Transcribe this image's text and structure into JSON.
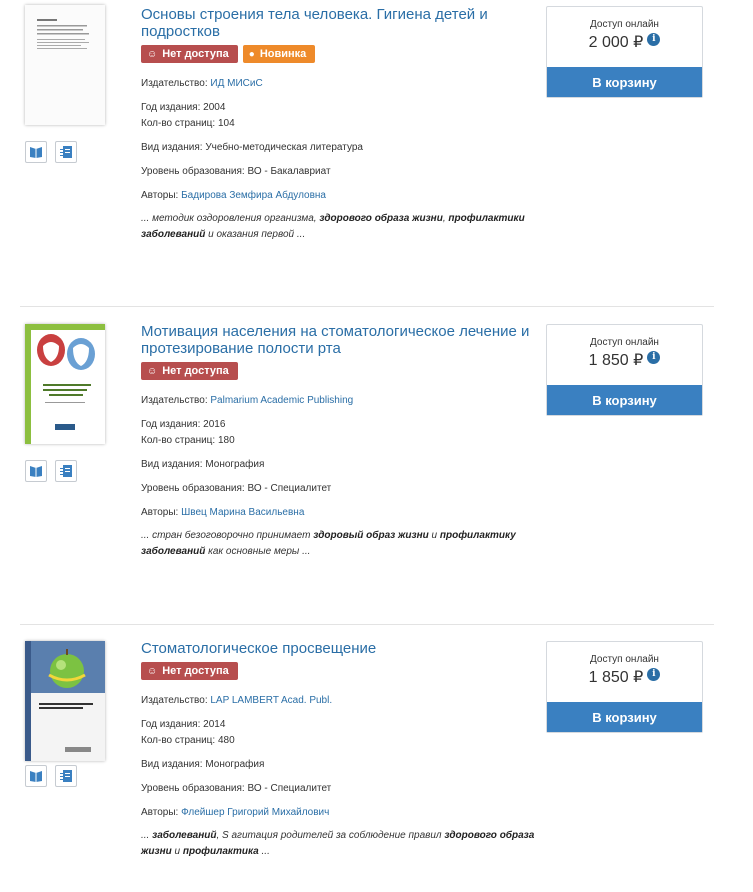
{
  "ui": {
    "badge_no_access": "Нет доступа",
    "badge_new": "Новинка",
    "publisher_label": "Издательство:",
    "year_label": "Год издания:",
    "pages_label": "Кол-во страниц:",
    "type_label": "Вид издания:",
    "level_label": "Уровень образования:",
    "authors_label": "Авторы:",
    "price_label": "Доступ онлайн",
    "cart_label": "В корзину",
    "colors": {
      "link": "#2a6ea6",
      "no_access": "#b74e4e",
      "new": "#ee8a2a",
      "cart": "#3a80c1"
    },
    "icons": [
      "book-reader-icon",
      "read-online-icon",
      "info-icon",
      "lock-icon",
      "dot-icon"
    ]
  },
  "items": [
    {
      "title": "Основы строения тела человека. Гигиена детей и подростков",
      "is_new": true,
      "publisher": "ИД МИСиС",
      "year": "2004",
      "pages": "104",
      "type": "Учебно-методическая литература",
      "level": "ВО - Бакалавриат",
      "authors": "Бадирова Земфира Абдуловна",
      "snippet": [
        {
          "t": "... методик оздоровления организма, ",
          "b": false
        },
        {
          "t": "здорового образа жизни",
          "b": true
        },
        {
          "t": ", ",
          "b": false
        },
        {
          "t": "профилактики заболеваний",
          "b": true
        },
        {
          "t": " и оказания первой ...",
          "b": false
        }
      ],
      "price": "2 000 ₽"
    },
    {
      "title": "Мотивация населения на стоматологическое лечение и протезирование полости рта",
      "is_new": false,
      "publisher": "Palmarium Academic Publishing",
      "year": "2016",
      "pages": "180",
      "type": "Монография",
      "level": "ВО - Специалитет",
      "authors": "Швец Марина Васильевна",
      "snippet": [
        {
          "t": "... стран безоговорочно принимает ",
          "b": false
        },
        {
          "t": "здоровый образ жизни",
          "b": true
        },
        {
          "t": " и ",
          "b": false
        },
        {
          "t": "профилактику заболеваний",
          "b": true
        },
        {
          "t": " как основные меры ...",
          "b": false
        }
      ],
      "price": "1 850 ₽"
    },
    {
      "title": "Стоматологическое просвещение",
      "is_new": false,
      "publisher": "LAP LAMBERT Acad. Publ.",
      "year": "2014",
      "pages": "480",
      "type": "Монография",
      "level": "ВО - Специалитет",
      "authors": "Флейшер Григорий Михайлович",
      "snippet": [
        {
          "t": "... ",
          "b": false
        },
        {
          "t": "заболеваний",
          "b": true
        },
        {
          "t": ", S агитация родителей за соблюдение правил ",
          "b": false
        },
        {
          "t": "здорового образа жизни",
          "b": true
        },
        {
          "t": " и ",
          "b": false
        },
        {
          "t": "профилактика",
          "b": true
        },
        {
          "t": " ...",
          "b": false
        }
      ],
      "price": "1 850 ₽"
    }
  ]
}
